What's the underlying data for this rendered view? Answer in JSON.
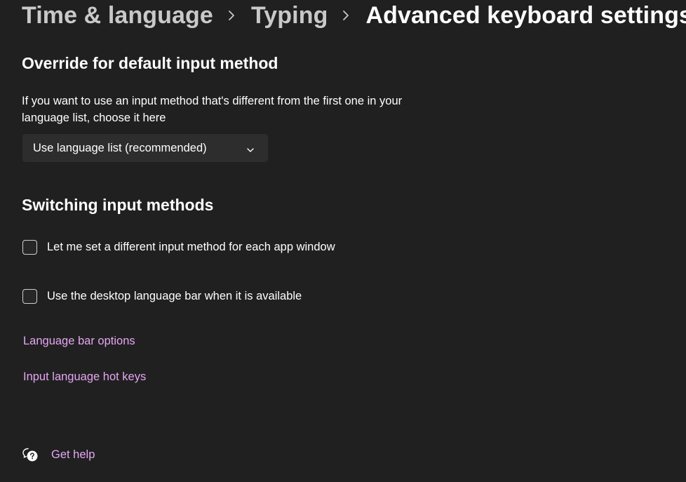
{
  "breadcrumb": {
    "items": [
      "Time & language",
      "Typing"
    ],
    "current": "Advanced keyboard settings"
  },
  "override": {
    "title": "Override for default input method",
    "description": "If you want to use an input method that's different from the first one in your language list, choose it here",
    "dropdown_value": "Use language list (recommended)"
  },
  "switching": {
    "title": "Switching input methods",
    "checkboxes": [
      {
        "label": "Let me set a different input method for each app window",
        "checked": false
      },
      {
        "label": "Use the desktop language bar when it is available",
        "checked": false
      }
    ]
  },
  "links": {
    "language_bar_options": "Language bar options",
    "input_hot_keys": "Input language hot keys"
  },
  "help": {
    "label": "Get help",
    "icon": "help-chat-icon"
  },
  "colors": {
    "background": "#202020",
    "link": "#e5a6f2",
    "control": "#2d2d2d"
  }
}
